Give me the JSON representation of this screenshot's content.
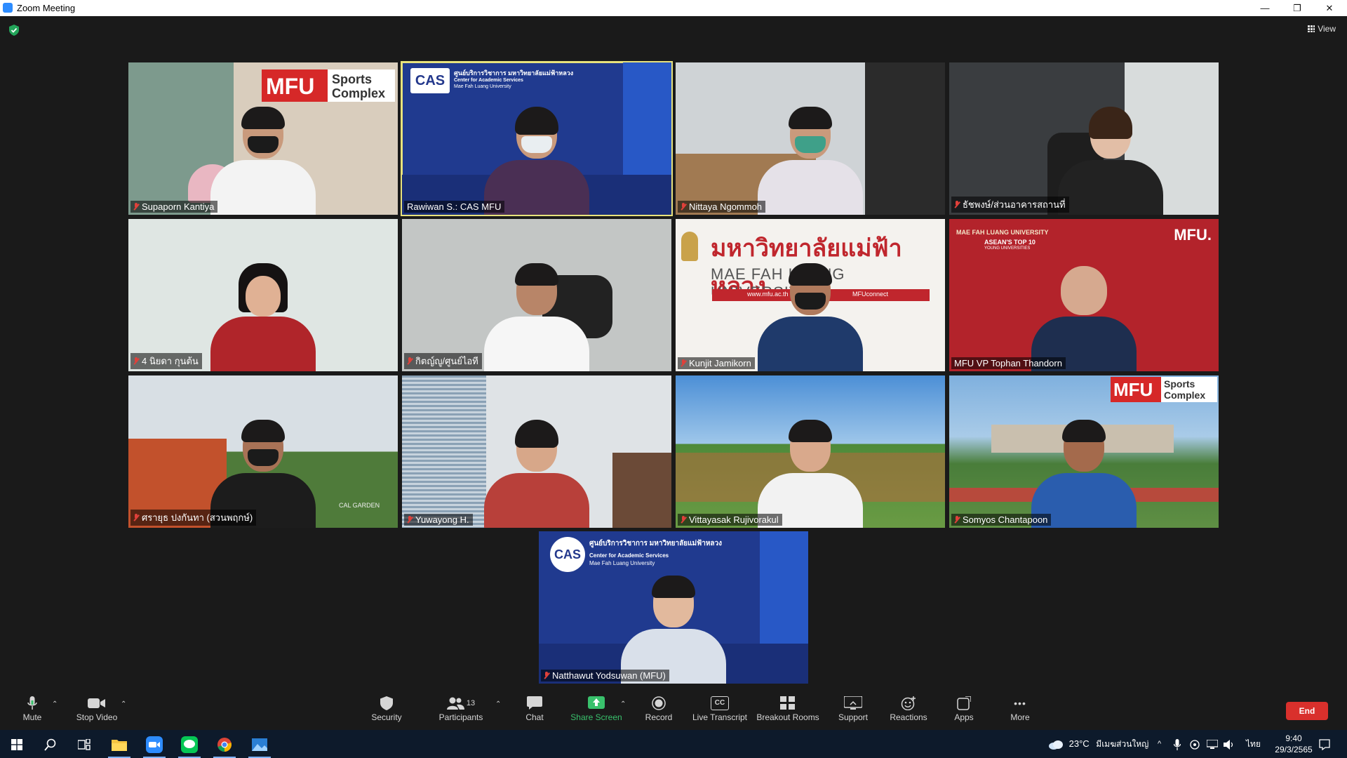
{
  "window": {
    "title": "Zoom Meeting",
    "minimize_glyph": "—",
    "restore_glyph": "❐",
    "close_glyph": "✕"
  },
  "header": {
    "shield_color": "#23a55a",
    "view_label": "View"
  },
  "participants": [
    {
      "name": "Supaporn Kantiya",
      "muted": true
    },
    {
      "name": "Rawiwan S.: CAS MFU",
      "muted": false,
      "active_speaker": true
    },
    {
      "name": "Nittaya Ngommoh",
      "muted": true
    },
    {
      "name": "ธัชพงษ์/ส่วนอาคารสถานที่",
      "muted": true
    },
    {
      "name": "4 นิยดา กุนต้น",
      "muted": true
    },
    {
      "name": "กิตญ์ญู/ศูนย์ไอที",
      "muted": true
    },
    {
      "name": "Kunjit Jamikorn",
      "muted": true
    },
    {
      "name": "MFU VP Tophan Thandorn",
      "muted": false
    },
    {
      "name": "ศรายุธ ปงกันทา (สวนพฤกษ์)",
      "muted": true
    },
    {
      "name": "Yuwayong H.",
      "muted": true
    },
    {
      "name": "Vittayasak Rujivorakul",
      "muted": true
    },
    {
      "name": "Somyos Chantapoon",
      "muted": true
    },
    {
      "name": "Natthawut Yodsuwan (MFU)",
      "muted": true
    }
  ],
  "backgrounds": {
    "mfu_logo": "MFU",
    "sports_line1": "Sports",
    "sports_line2": "Complex",
    "cas_logo": "CAS",
    "cas_thai": "ศูนย์บริการวิชาการ มหาวิทยาลัยแม่ฟ้าหลวง",
    "cas_en1": "Center for Academic Services",
    "cas_en2": "Mae Fah Luang University",
    "univ_thai": "มหาวิทยาลัยแม่ฟ้าหลวง",
    "univ_en": "MAE FAH LUANG UNIVERSITY",
    "univ_web": "www.mfu.ac.th",
    "univ_social": "MFUconnect",
    "vp_univ": "MAE FAH LUANG UNIVERSITY",
    "vp_rank": "ASEAN'S TOP 10",
    "vp_rank_sub": "YOUNG UNIVERSITIES",
    "vp_logo": "MFU.",
    "garden_sign": "CAL GARDEN"
  },
  "toolbar": {
    "mute": "Mute",
    "stop_video": "Stop Video",
    "security": "Security",
    "participants": "Participants",
    "participants_count": "13",
    "chat": "Chat",
    "share_screen": "Share Screen",
    "record": "Record",
    "live_transcript": "Live Transcript",
    "cc_glyph": "CC",
    "breakout_rooms": "Breakout Rooms",
    "support": "Support",
    "reactions": "Reactions",
    "apps": "Apps",
    "more": "More",
    "more_glyph": "•••",
    "end": "End",
    "share_color": "#39c16c",
    "end_color": "#d9302c"
  },
  "taskbar": {
    "weather": "23°C",
    "location": "มีเมฆส่วนใหญ่",
    "lang": "ไทย",
    "time": "9:40",
    "date": "29/3/2565"
  }
}
